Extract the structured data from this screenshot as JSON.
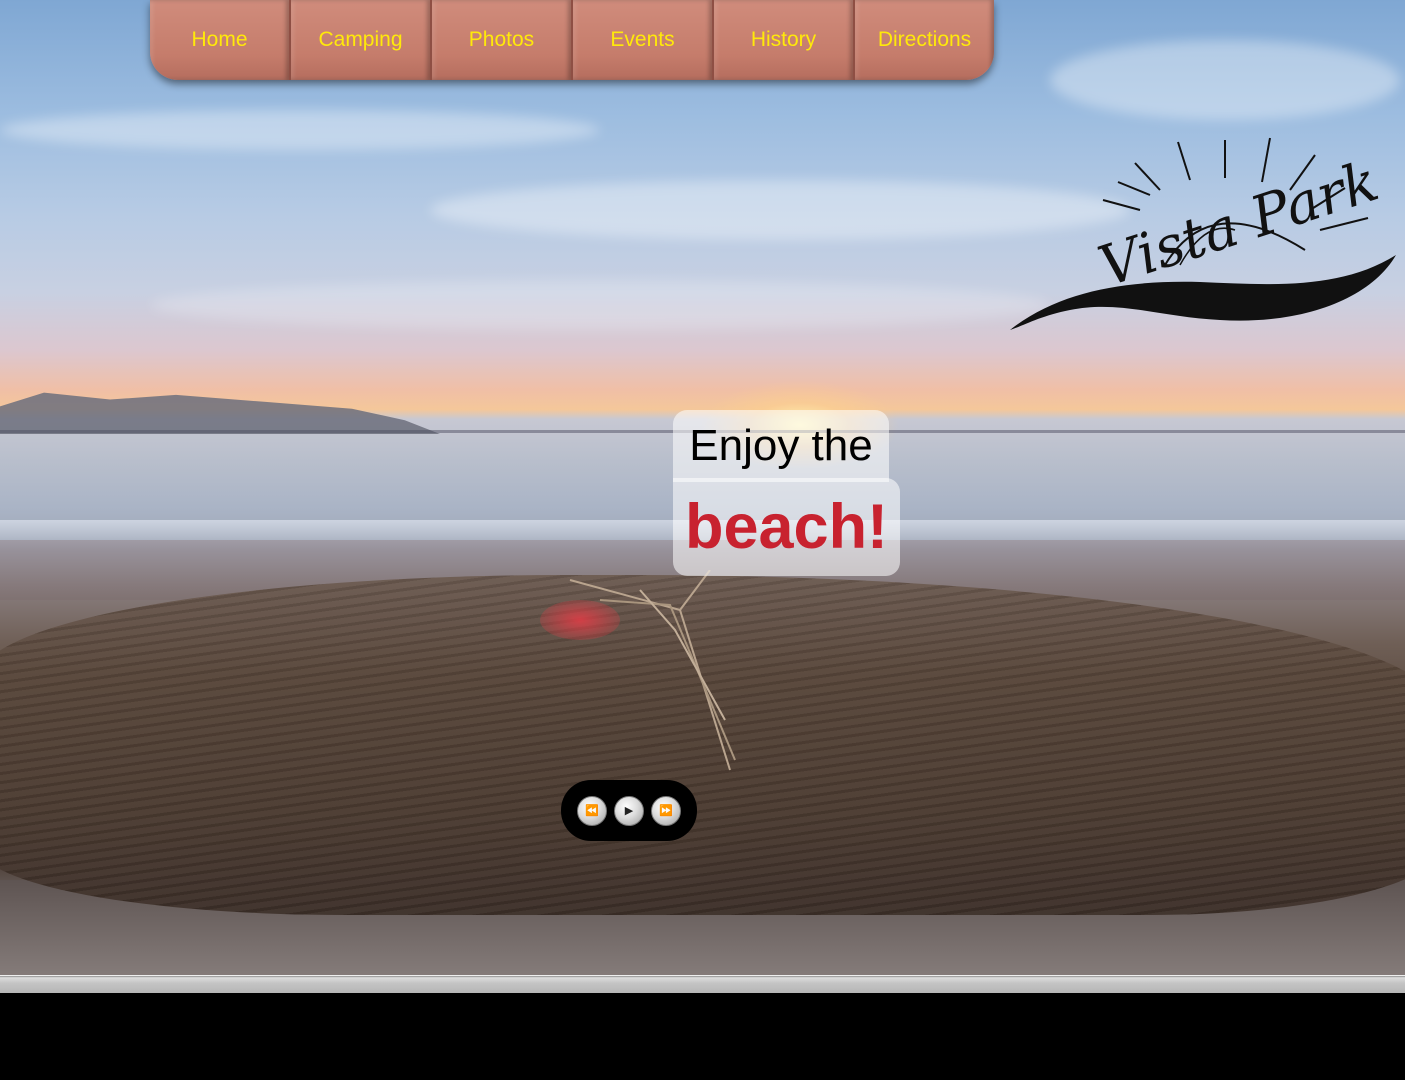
{
  "nav": {
    "items": [
      {
        "label": "Home"
      },
      {
        "label": "Camping"
      },
      {
        "label": "Photos"
      },
      {
        "label": "Events"
      },
      {
        "label": "History"
      },
      {
        "label": "Directions"
      }
    ],
    "text_color": "#ffe90a",
    "background_color": "#c57c6b"
  },
  "logo": {
    "text": "Vista Park",
    "icon": "sun-over-wave-logo"
  },
  "hero": {
    "caption_line1": "Enjoy the",
    "caption_line2": "beach!",
    "caption_accent_color": "#c8222f",
    "image": "sunset-beach-driftwood-photo"
  },
  "slider": {
    "controls": [
      {
        "icon": "rewind-icon",
        "glyph": "⏪"
      },
      {
        "icon": "play-icon",
        "glyph": "▶"
      },
      {
        "icon": "fast-forward-icon",
        "glyph": "⏩"
      }
    ]
  }
}
